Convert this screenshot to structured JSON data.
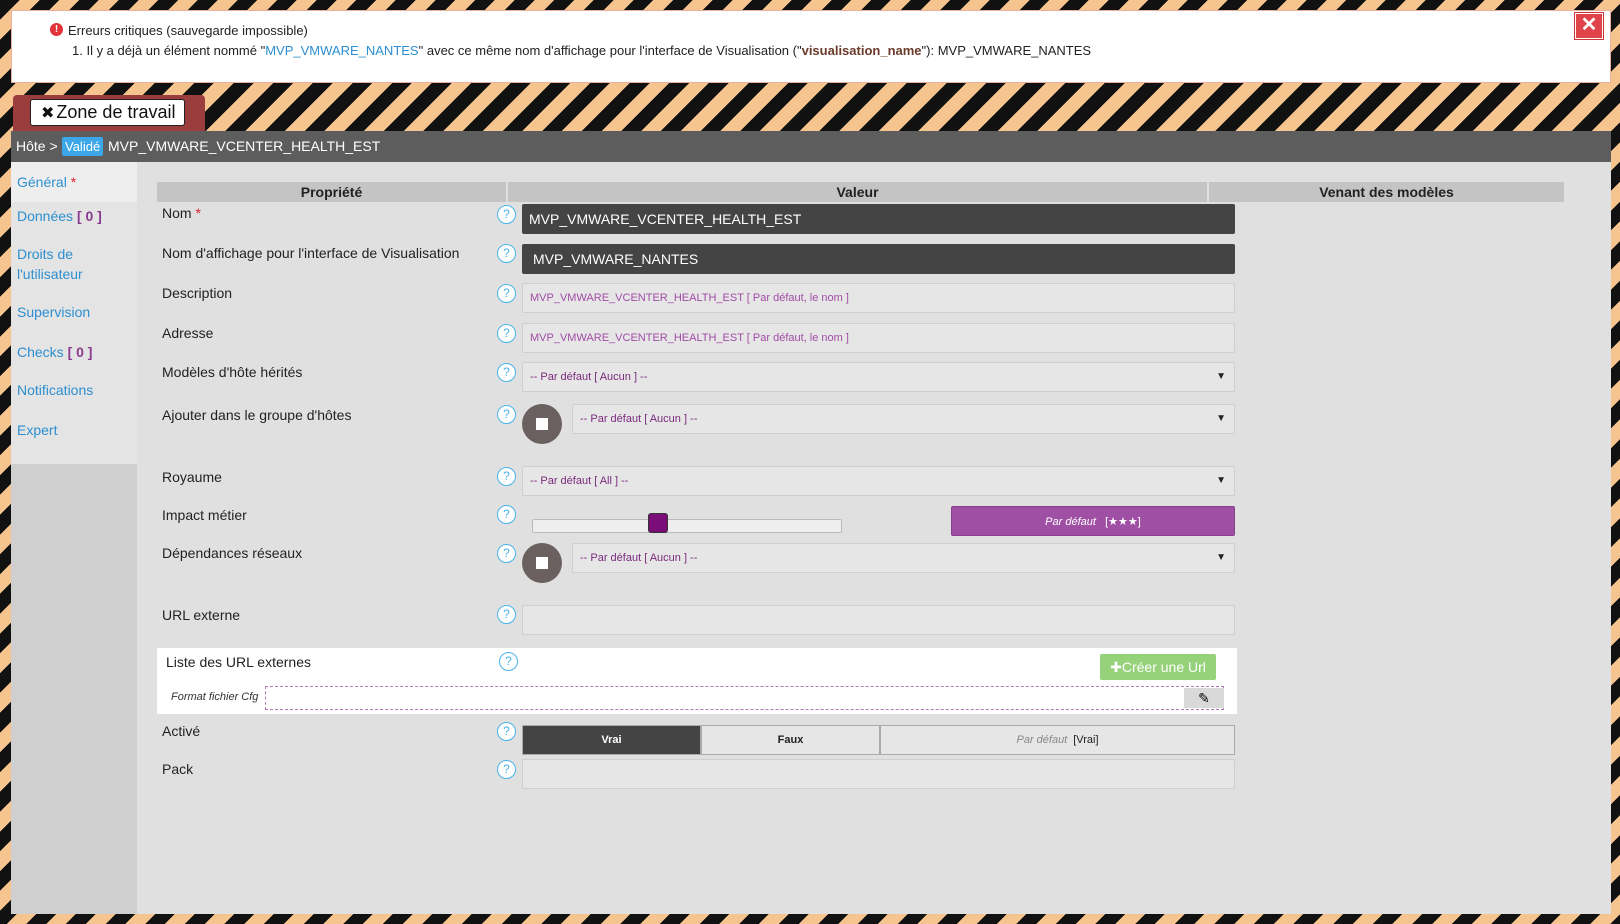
{
  "error": {
    "title": "Erreurs critiques (sauvegarde impossible)",
    "line_prefix": "1. Il y a déjà un élément nommé \"",
    "element_name": "MVP_VMWARE_NANTES",
    "line_middle": "\" avec ce même nom d'affichage pour l'interface de Visualisation (\"",
    "field_name": "visualisation_name",
    "line_suffix": "\"): MVP_VMWARE_NANTES",
    "close_icon": "close-icon"
  },
  "workspace": {
    "label": "Zone de travail",
    "icon": "tools-icon"
  },
  "breadcrumb": {
    "host": "Hôte >",
    "badge": "Validé",
    "name": "MVP_VMWARE_VCENTER_HEALTH_EST"
  },
  "sidebar": {
    "general": "Général",
    "general_required": "*",
    "donnees": "Données",
    "donnees_count": "[ 0 ]",
    "droits_line1": "Droits de",
    "droits_line2": "l'utilisateur",
    "supervision": "Supervision",
    "checks": "Checks",
    "checks_count": "[ 0 ]",
    "notifications": "Notifications",
    "expert": "Expert"
  },
  "table": {
    "col_property": "Propriété",
    "col_value": "Valeur",
    "col_templates": "Venant des modèles"
  },
  "fields": {
    "nom_label": "Nom",
    "nom_required": "*",
    "nom_value": "MVP_VMWARE_VCENTER_HEALTH_EST",
    "display_label": "Nom d'affichage pour l'interface de Visualisation",
    "display_value": "MVP_VMWARE_NANTES",
    "description_label": "Description",
    "description_placeholder": "MVP_VMWARE_VCENTER_HEALTH_EST [ Par défaut, le nom ]",
    "address_label": "Adresse",
    "address_placeholder": "MVP_VMWARE_VCENTER_HEALTH_EST [ Par défaut, le nom ]",
    "templates_label": "Modèles d'hôte hérités",
    "templates_value": "-- Par défaut [ Aucun ] --",
    "hostgroup_label": "Ajouter dans le groupe d'hôtes",
    "hostgroup_value": "-- Par défaut [ Aucun ] --",
    "realm_label": "Royaume",
    "realm_value": "-- Par défaut [ All ] --",
    "impact_label": "Impact métier",
    "impact_default_label": "Par défaut",
    "impact_default_value": "[★★★]",
    "impact_level": 0.4,
    "deps_label": "Dépendances réseaux",
    "deps_value": "-- Par défaut [ Aucun ] --",
    "url_label": "URL externe",
    "url_list_label": "Liste des URL externes",
    "create_url": "Créer une Url",
    "cfg_label": "Format fichier Cfg",
    "active_label": "Activé",
    "active_true": "Vrai",
    "active_false": "Faux",
    "active_default_label": "Par défaut",
    "active_default_value": "[Vrai]",
    "pack_label": "Pack"
  },
  "help_glyph": "?",
  "colors": {
    "accent": "#2d8fd1",
    "purple": "#a050a4",
    "error": "#e2343b",
    "green": "#95d279"
  }
}
